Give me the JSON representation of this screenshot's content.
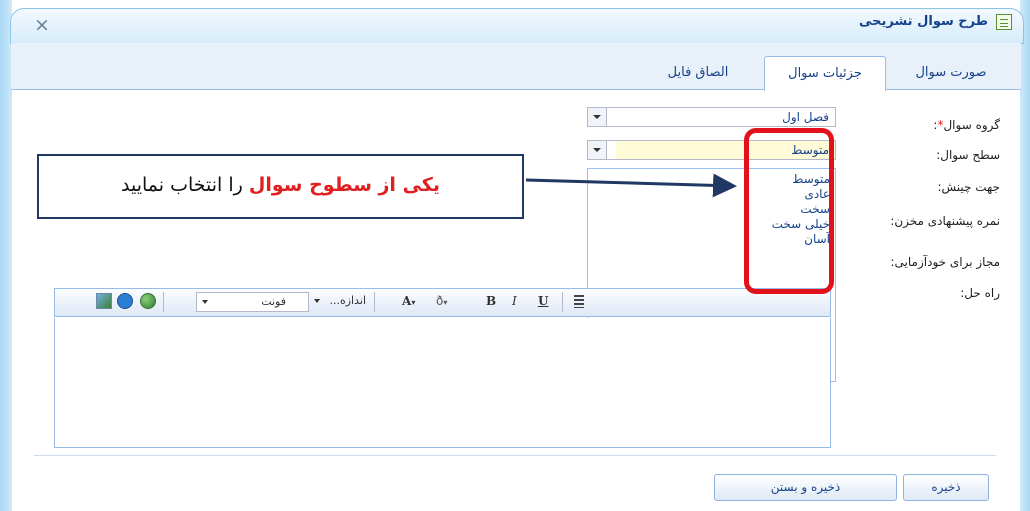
{
  "window": {
    "title": "طرح سوال تشریحی",
    "close_glyph": "×"
  },
  "tabs": [
    {
      "label": "صورت سوال",
      "active": false
    },
    {
      "label": "جزئیات سوال",
      "active": true
    },
    {
      "label": "الصاق فایل",
      "active": false
    }
  ],
  "form": {
    "group_label": "گروه سوال",
    "required_mark": "*",
    "group_colon": ":",
    "group_value": "فصل اول",
    "level_label": "سطح سوال:",
    "level_value": "متوسط",
    "direction_label": "جهت چینش:",
    "score_label": "نمره پیشنهادی مخزن:",
    "self_test_label": "مجاز برای خودآزمایی:",
    "solution_label": "راه حل:"
  },
  "level_options": [
    "متوسط",
    "عادی",
    "سخت",
    "خیلی سخت",
    "آسان"
  ],
  "editor_toolbar": {
    "font_select": "فونت",
    "size_select": "اندازه...",
    "text_color_glyph": "A",
    "highlight_glyph": "ð",
    "bold": "B",
    "italic": "I",
    "underline": "U"
  },
  "buttons": {
    "save": "ذخیره",
    "save_close": "ذخیره و بستن"
  },
  "annotation": {
    "highlight": "یکی از سطوح سوال",
    "rest": " را انتخاب نمایید"
  },
  "colors": {
    "accent": "#15428b",
    "annotation_red": "#e2111b",
    "annotation_border": "#1f3864"
  }
}
